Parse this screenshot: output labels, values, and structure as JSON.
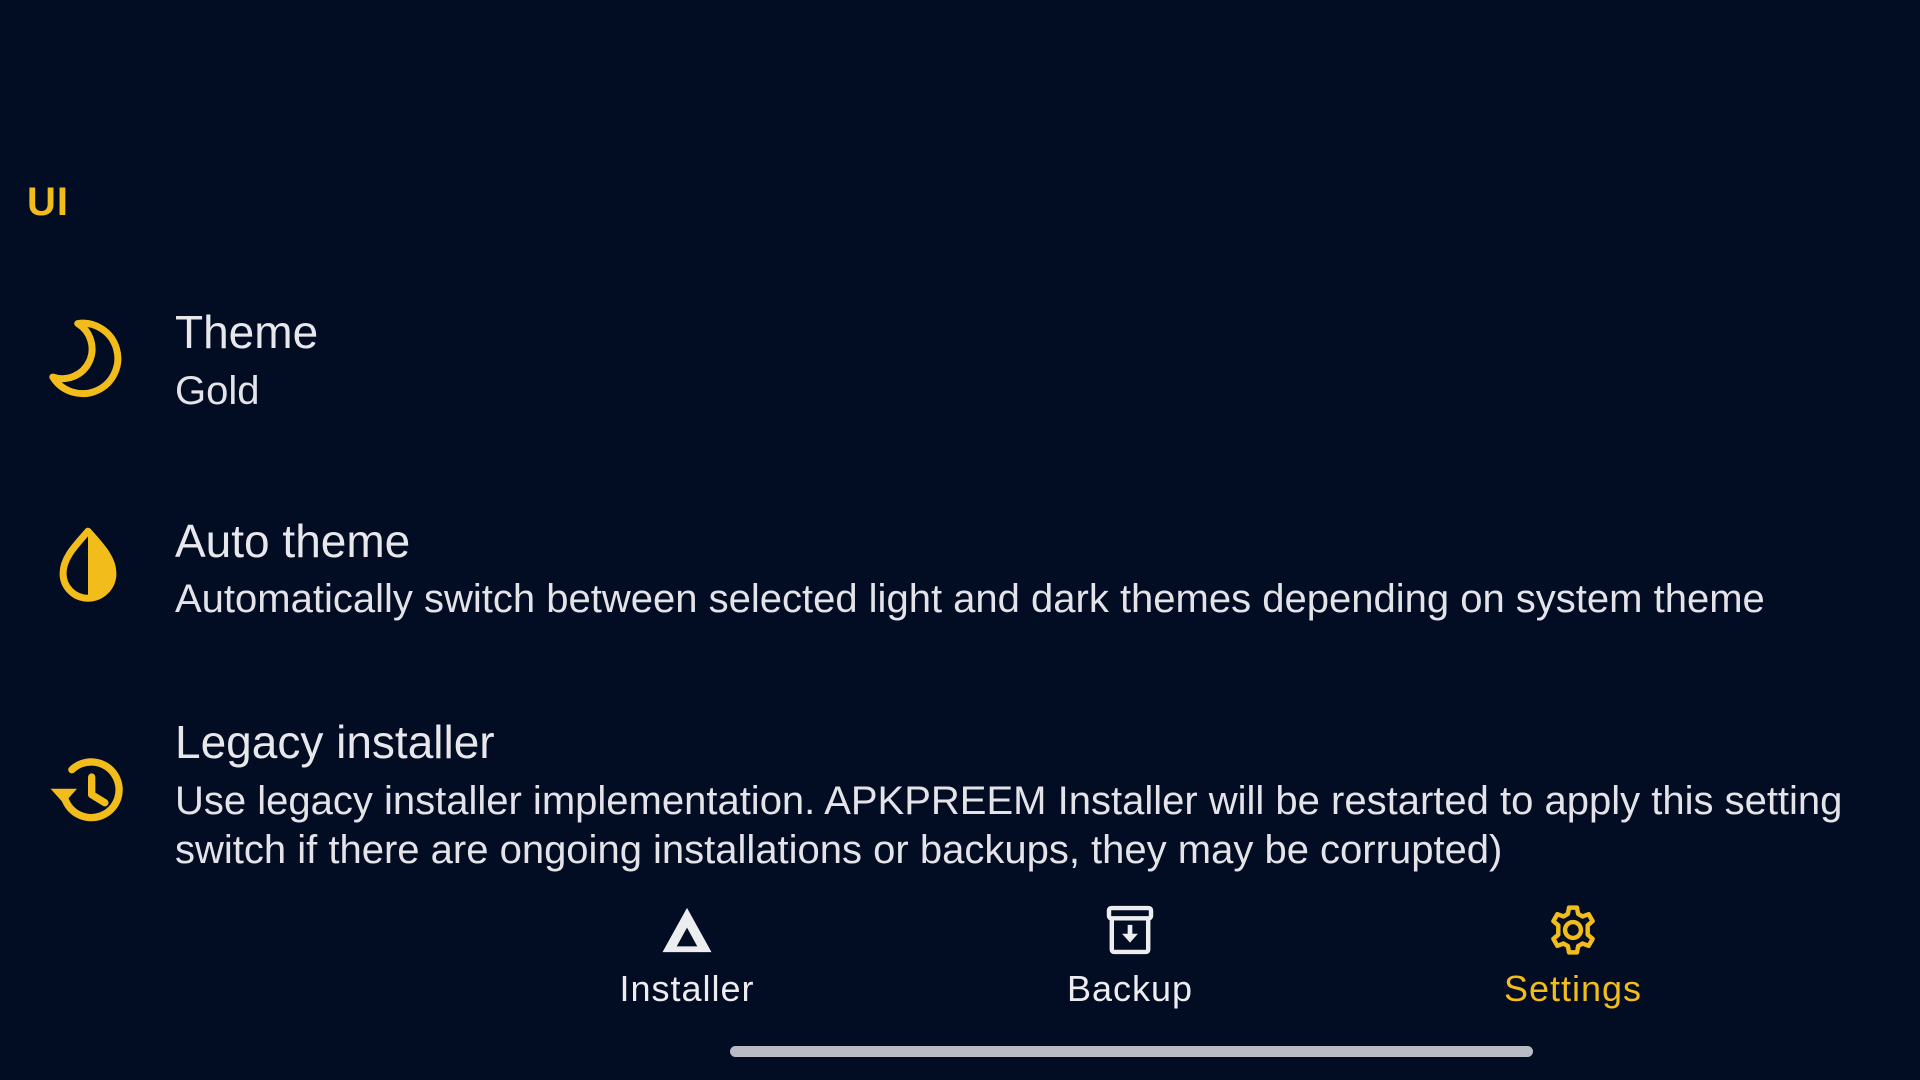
{
  "colors": {
    "background": "#020d24",
    "accent": "#f2bc1b",
    "text": "#e8e8ec"
  },
  "section": {
    "header": "UI"
  },
  "preferences": [
    {
      "icon": "moon-icon",
      "title": "Theme",
      "summary_lines": [
        "Gold"
      ]
    },
    {
      "icon": "contrast-drop-icon",
      "title": "Auto theme",
      "summary_lines": [
        "Automatically switch between selected light and dark themes depending on system theme"
      ]
    },
    {
      "icon": "history-icon",
      "title": "Legacy installer",
      "summary_lines": [
        "Use legacy installer implementation. APKPREEM Installer will be restarted to apply this setting",
        "switch if there are ongoing installations or backups, they may be corrupted)"
      ]
    }
  ],
  "bottom_nav": {
    "items": [
      {
        "icon": "installer-triangle-icon",
        "label": "Installer",
        "active": false
      },
      {
        "icon": "backup-archive-icon",
        "label": "Backup",
        "active": false
      },
      {
        "icon": "gear-icon",
        "label": "Settings",
        "active": true
      }
    ]
  }
}
